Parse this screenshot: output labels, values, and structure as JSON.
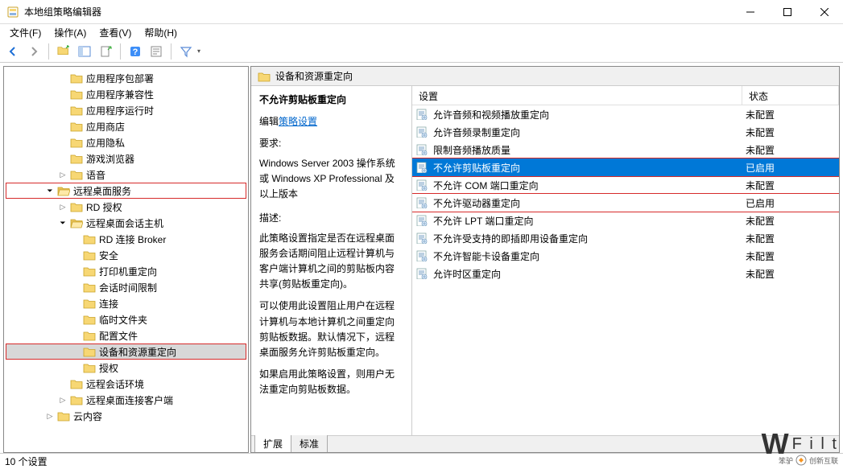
{
  "titlebar": {
    "title": "本地组策略编辑器"
  },
  "menu": {
    "file": "文件(F)",
    "action": "操作(A)",
    "view": "查看(V)",
    "help": "帮助(H)"
  },
  "tree": {
    "items": [
      {
        "ind": 4,
        "arrow": "",
        "label": "应用程序包部署"
      },
      {
        "ind": 4,
        "arrow": "",
        "label": "应用程序兼容性"
      },
      {
        "ind": 4,
        "arrow": "",
        "label": "应用程序运行时"
      },
      {
        "ind": 4,
        "arrow": "",
        "label": "应用商店"
      },
      {
        "ind": 4,
        "arrow": "",
        "label": "应用隐私"
      },
      {
        "ind": 4,
        "arrow": "",
        "label": "游戏浏览器"
      },
      {
        "ind": 4,
        "arrow": "closed",
        "label": "语音"
      },
      {
        "ind": 3,
        "arrow": "open",
        "label": "远程桌面服务",
        "red": true
      },
      {
        "ind": 4,
        "arrow": "closed",
        "label": "RD 授权"
      },
      {
        "ind": 4,
        "arrow": "open",
        "label": "远程桌面会话主机"
      },
      {
        "ind": 5,
        "arrow": "",
        "label": "RD 连接 Broker"
      },
      {
        "ind": 5,
        "arrow": "",
        "label": "安全"
      },
      {
        "ind": 5,
        "arrow": "",
        "label": "打印机重定向"
      },
      {
        "ind": 5,
        "arrow": "",
        "label": "会话时间限制"
      },
      {
        "ind": 5,
        "arrow": "",
        "label": "连接"
      },
      {
        "ind": 5,
        "arrow": "",
        "label": "临时文件夹"
      },
      {
        "ind": 5,
        "arrow": "",
        "label": "配置文件"
      },
      {
        "ind": 5,
        "arrow": "",
        "label": "设备和资源重定向",
        "sel": true,
        "red": true
      },
      {
        "ind": 5,
        "arrow": "",
        "label": "授权"
      },
      {
        "ind": 4,
        "arrow": "",
        "label": "远程会话环境"
      },
      {
        "ind": 4,
        "arrow": "closed",
        "label": "远程桌面连接客户端"
      },
      {
        "ind": 3,
        "arrow": "closed",
        "label": "云内容"
      }
    ]
  },
  "path_header": "设备和资源重定向",
  "description": {
    "title": "不允许剪贴板重定向",
    "edit_label": "编辑",
    "edit_link": "策略设置",
    "req_label": "要求:",
    "req_body": "Windows Server 2003 操作系统或 Windows XP Professional 及以上版本",
    "desc_label": "描述:",
    "desc_p1": "此策略设置指定是否在远程桌面服务会话期间阻止远程计算机与客户端计算机之间的剪贴板内容共享(剪贴板重定向)。",
    "desc_p2": "可以使用此设置阻止用户在远程计算机与本地计算机之间重定向剪贴板数据。默认情况下，远程桌面服务允许剪贴板重定向。",
    "desc_p3": "如果启用此策略设置，则用户无法重定向剪贴板数据。"
  },
  "list": {
    "col_setting": "设置",
    "col_state": "状态",
    "rows": [
      {
        "label": "允许音频和视频播放重定向",
        "state": "未配置"
      },
      {
        "label": "允许音频录制重定向",
        "state": "未配置"
      },
      {
        "label": "限制音频播放质量",
        "state": "未配置"
      },
      {
        "label": "不允许剪贴板重定向",
        "state": "已启用",
        "sel": true,
        "red": true
      },
      {
        "label": "不允许 COM 端口重定向",
        "state": "未配置"
      },
      {
        "label": "不允许驱动器重定向",
        "state": "已启用",
        "red": true
      },
      {
        "label": "不允许 LPT 端口重定向",
        "state": "未配置"
      },
      {
        "label": "不允许受支持的即插即用设备重定向",
        "state": "未配置"
      },
      {
        "label": "不允许智能卡设备重定向",
        "state": "未配置"
      },
      {
        "label": "允许时区重定向",
        "state": "未配置"
      }
    ]
  },
  "tabs": {
    "extended": "扩展",
    "standard": "标准"
  },
  "statusbar": "10 个设置",
  "watermark": {
    "w": "W",
    "txt": "F i l t",
    "sub": "笨驴",
    "brand": "创新互联"
  }
}
